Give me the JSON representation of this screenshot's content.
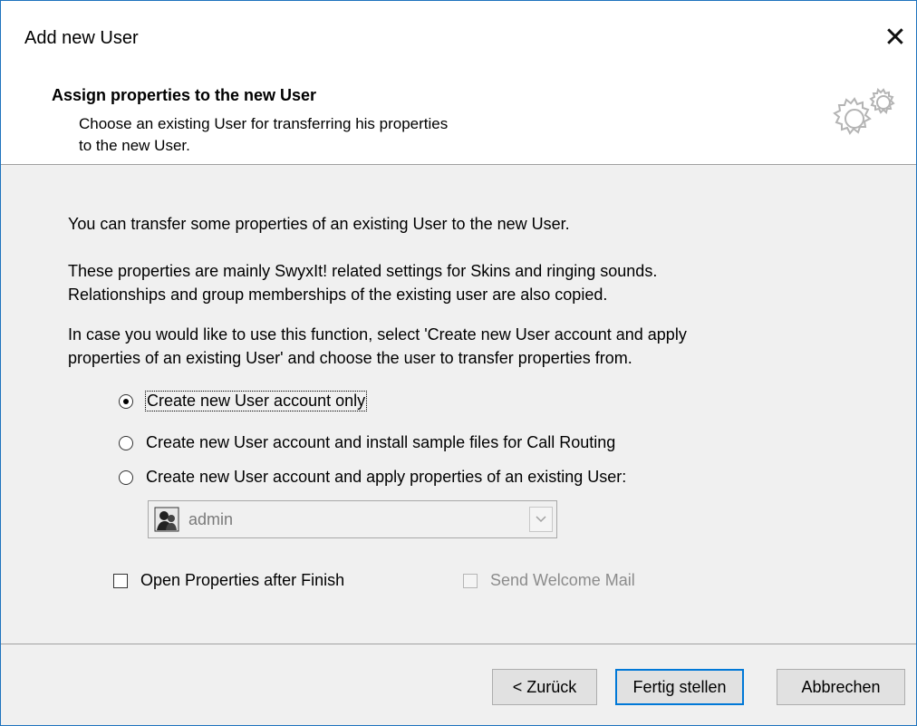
{
  "window": {
    "title": "Add new User",
    "close_icon": "close-icon"
  },
  "header": {
    "title": "Assign properties to the new User",
    "description_line1": "Choose an existing User for transferring his properties",
    "description_line2": "to the new User.",
    "icon": "gears-icon"
  },
  "content": {
    "para1": "You can transfer some properties of an existing User to the new User.",
    "para2_line1": "These properties are mainly SwyxIt! related settings for Skins and ringing sounds.",
    "para2_line2": "Relationships and group memberships of the existing user are also copied.",
    "para3_line1": "In case you would like to use this function, select 'Create new User account and apply",
    "para3_line2": "properties of an existing User' and choose the user to transfer properties from."
  },
  "options": [
    {
      "label": "Create new User account only",
      "selected": true
    },
    {
      "label": "Create new User account and install sample files for Call Routing",
      "selected": false
    },
    {
      "label": "Create new User account and apply properties of an existing User:",
      "selected": false
    }
  ],
  "user_select": {
    "value": "admin",
    "enabled": false,
    "icon": "user-icon"
  },
  "checkboxes": {
    "open_properties": {
      "label": "Open Properties after Finish",
      "checked": false,
      "enabled": true
    },
    "send_welcome": {
      "label": "Send Welcome Mail",
      "checked": false,
      "enabled": false
    }
  },
  "buttons": {
    "back": "< Zurück",
    "finish": "Fertig stellen",
    "cancel": "Abbrechen"
  },
  "colors": {
    "window_border": "#1e73be",
    "default_button_border": "#0078d7"
  }
}
